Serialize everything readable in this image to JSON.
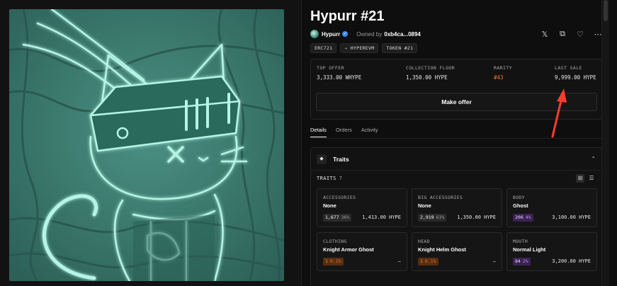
{
  "title": "Hypurr #21",
  "creator": {
    "name": "Hypurr",
    "owned_label": "Owned by",
    "owner": "0xb4ca...0894"
  },
  "actions": {
    "x_icon": "x-logo-icon",
    "copy_icon": "copy-icon",
    "favorite_icon": "heart-icon",
    "more_icon": "more-icon"
  },
  "chips": [
    "ERC721",
    "⇢ HYPEREVM",
    "TOKEN #21"
  ],
  "stats": [
    {
      "label": "TOP OFFER",
      "value": "3,333.00 WHYPE"
    },
    {
      "label": "COLLECTION FLOOR",
      "value": "1,350.00 HYPE"
    },
    {
      "label": "RARITY",
      "value": "#43"
    },
    {
      "label": "LAST SALE",
      "value": "9,999.00 HYPE"
    }
  ],
  "make_offer_label": "Make offer",
  "tabs": [
    "Details",
    "Orders",
    "Activity"
  ],
  "traits": {
    "title": "Traits",
    "count_label": "TRAITS",
    "count": "7",
    "items": [
      {
        "category": "ACCESSORIES",
        "value": "None",
        "count": "1,677",
        "pct": "36%",
        "price": "1,413.00 HYPE",
        "tier": "common"
      },
      {
        "category": "BIG ACCESSORIES",
        "value": "None",
        "count": "2,919",
        "pct": "63%",
        "price": "1,350.00 HYPE",
        "tier": "common"
      },
      {
        "category": "BODY",
        "value": "Ghost",
        "count": "206",
        "pct": "4%",
        "price": "3,100.00 HYPE",
        "tier": "epic"
      },
      {
        "category": "CLOTHING",
        "value": "Knight Armor Ghost",
        "count": "1",
        "pct": "0.1%",
        "price": "–",
        "tier": "rare"
      },
      {
        "category": "HEAD",
        "value": "Knight Helm Ghost",
        "count": "1",
        "pct": "0.1%",
        "price": "–",
        "tier": "rare"
      },
      {
        "category": "MOUTH",
        "value": "Normal Light",
        "count": "84",
        "pct": "2%",
        "price": "3,200.00 HYPE",
        "tier": "epic"
      }
    ]
  },
  "colors": {
    "rarity": "#f27c2c",
    "annotation_arrow": "#ff3b30",
    "art_bg": "#3f7e72",
    "art_glow": "#a8f0e0"
  }
}
